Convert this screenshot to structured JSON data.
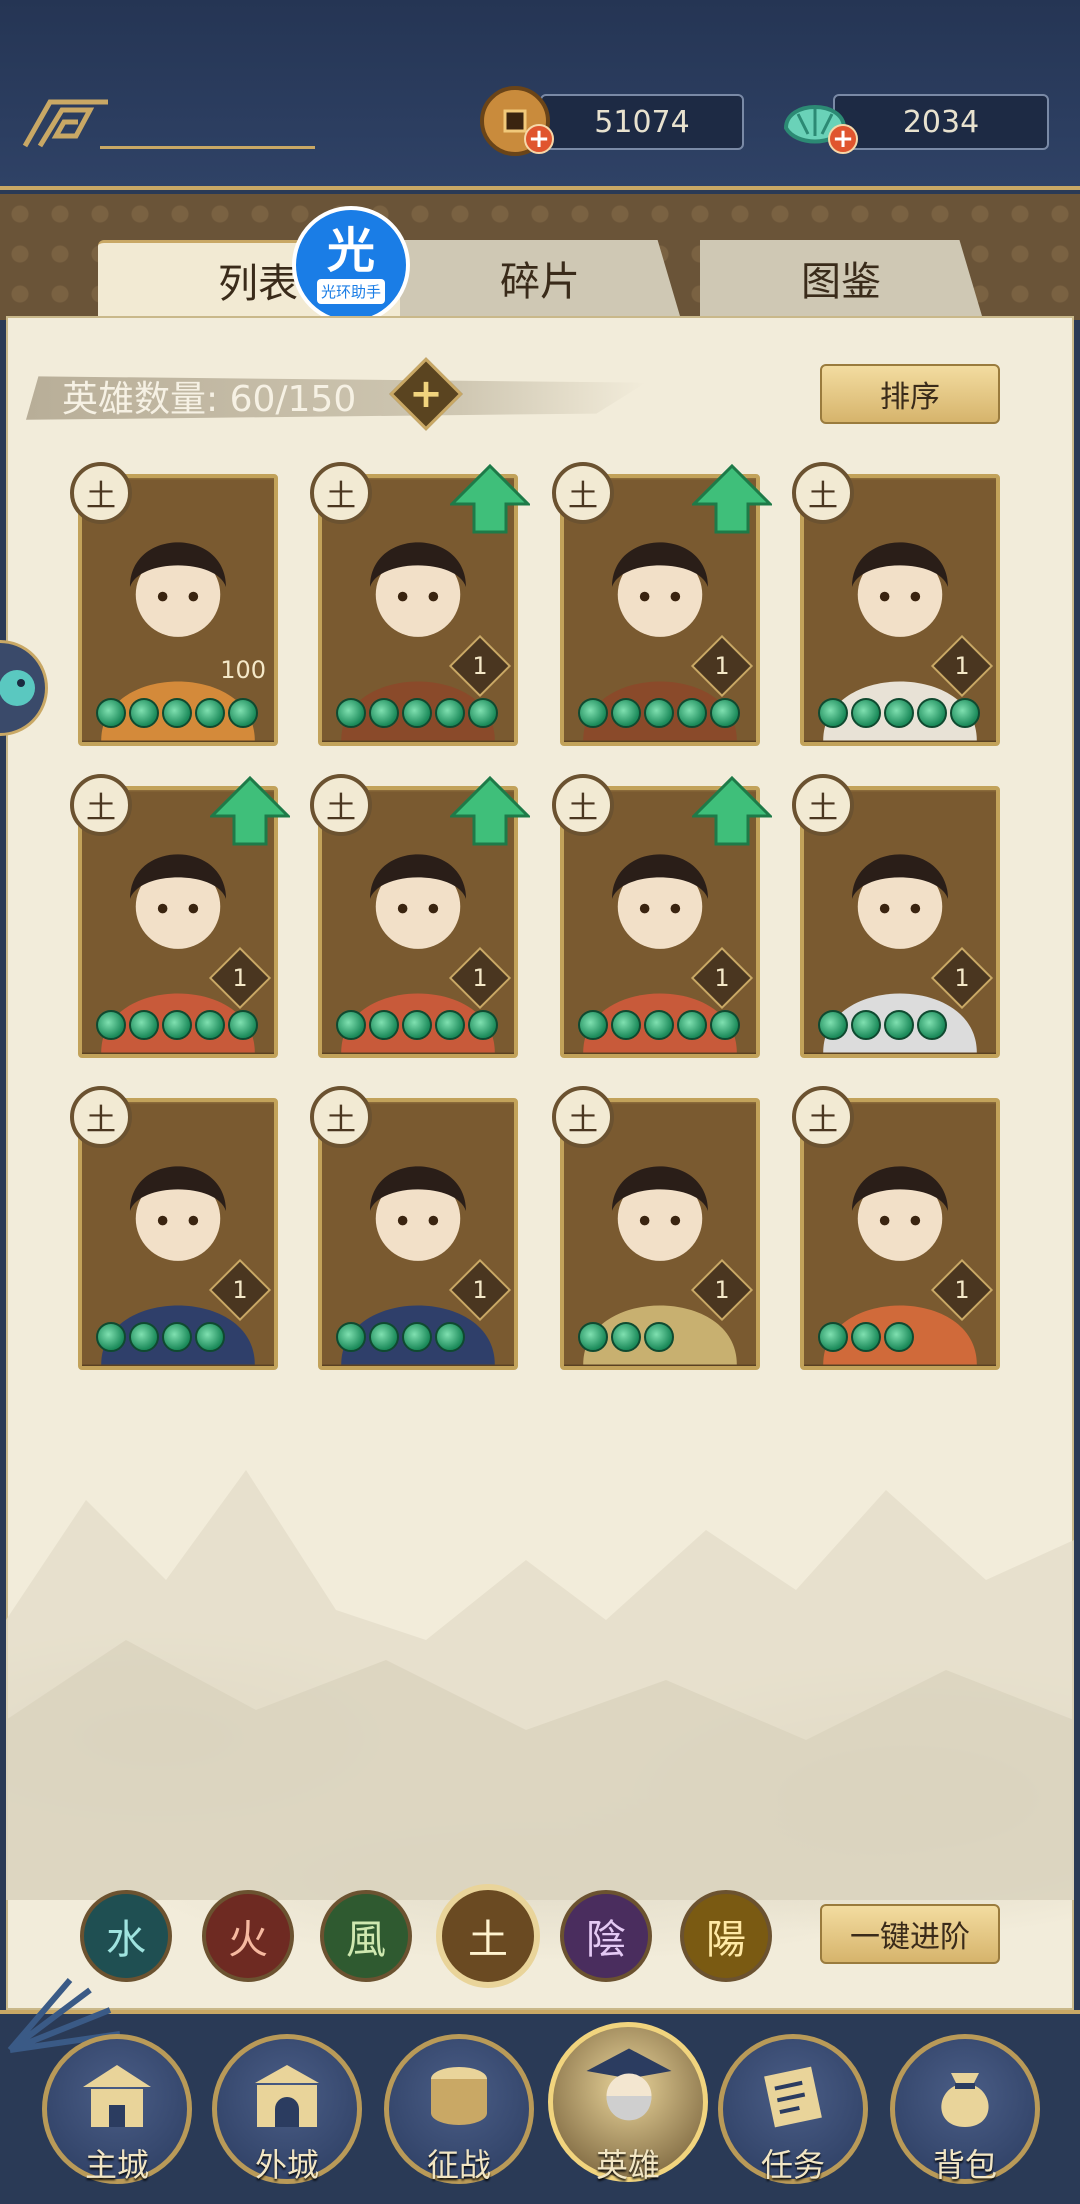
{
  "currencies": {
    "coins": "51074",
    "gems": "2034"
  },
  "helper_badge": {
    "glyph": "光",
    "label": "光环助手"
  },
  "tabs": [
    {
      "label": "列表"
    },
    {
      "label": "碎片"
    },
    {
      "label": "图鉴"
    }
  ],
  "hero_count": "英雄数量: 60/150",
  "add_symbol": "+",
  "sort_button": "排序",
  "advance_button": "一键进阶",
  "element_glyph": "土",
  "heroes": [
    {
      "level": "100",
      "stars": 5,
      "upgrade": false,
      "palette": "#d48a3a"
    },
    {
      "level": "1",
      "stars": 5,
      "upgrade": true,
      "palette": "#8a4a2a"
    },
    {
      "level": "1",
      "stars": 5,
      "upgrade": true,
      "palette": "#8a4a2a"
    },
    {
      "level": "1",
      "stars": 5,
      "upgrade": false,
      "palette": "#e8e2d6"
    },
    {
      "level": "1",
      "stars": 5,
      "upgrade": true,
      "palette": "#c85a3a"
    },
    {
      "level": "1",
      "stars": 5,
      "upgrade": true,
      "palette": "#c85a3a"
    },
    {
      "level": "1",
      "stars": 5,
      "upgrade": true,
      "palette": "#c85a3a"
    },
    {
      "level": "1",
      "stars": 4,
      "upgrade": false,
      "palette": "#dcdcdc"
    },
    {
      "level": "1",
      "stars": 4,
      "upgrade": false,
      "palette": "#2f3f6a"
    },
    {
      "level": "1",
      "stars": 4,
      "upgrade": false,
      "palette": "#2f3f6a"
    },
    {
      "level": "1",
      "stars": 3,
      "upgrade": false,
      "palette": "#c8b070"
    },
    {
      "level": "1",
      "stars": 3,
      "upgrade": false,
      "palette": "#d06a3a"
    }
  ],
  "element_filters": [
    "水",
    "火",
    "風",
    "土",
    "陰",
    "陽"
  ],
  "nav": [
    {
      "label": "主城"
    },
    {
      "label": "外城"
    },
    {
      "label": "征战"
    },
    {
      "label": "英雄"
    },
    {
      "label": "任务"
    },
    {
      "label": "背包"
    }
  ]
}
